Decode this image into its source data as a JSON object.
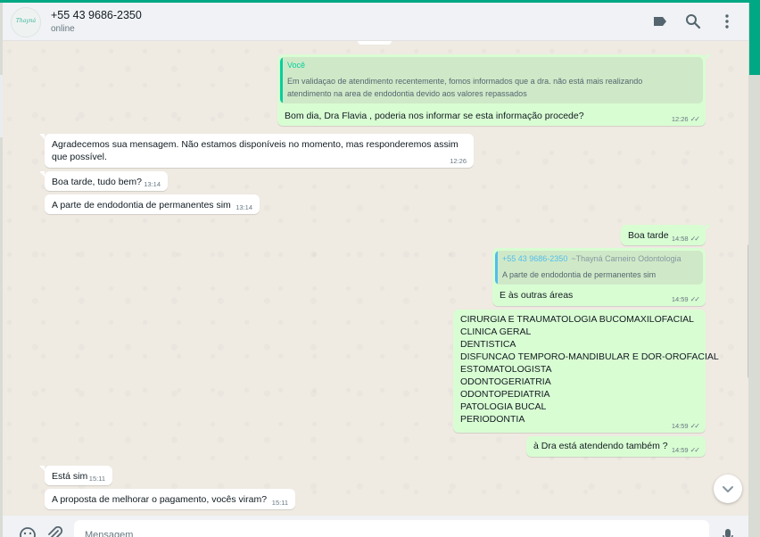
{
  "header": {
    "avatar_text": "Thayná",
    "contact_name": "+55 43 9686-2350",
    "status": "online",
    "icons": [
      "label-icon",
      "search-icon",
      "menu-icon"
    ]
  },
  "messages": [
    {
      "dir": "out",
      "quote": {
        "author": "Você",
        "sub": "",
        "text": "Em validaçao de atendimento recentemente, fomos informados que a dra. não está mais realizando\natendimento na area de endodontia devido aos valores repassados"
      },
      "text": "Bom dia, Dra Flavia , poderia nos informar se esta informação procede?",
      "time": "12:26",
      "ticks": "✓✓"
    },
    {
      "dir": "in",
      "text": "Agradecemos sua mensagem. Não estamos disponíveis no momento, mas responderemos assim\nque possível.",
      "time": "12:26"
    },
    {
      "dir": "in",
      "text": "Boa tarde, tudo bem?",
      "time": "13:14"
    },
    {
      "dir": "in",
      "text": "A parte de endodontia de permanentes sim",
      "time": "13:14"
    },
    {
      "dir": "out",
      "text": "Boa tarde",
      "time": "14:58",
      "ticks": "✓✓"
    },
    {
      "dir": "out",
      "quote": {
        "author": "+55 43 9686-2350",
        "sub": "~Thayná Carneiro Odontologia",
        "text": "A parte de endodontia de permanentes sim"
      },
      "text": "E às outras áreas",
      "time": "14:59",
      "ticks": "✓✓"
    },
    {
      "dir": "out",
      "text": "CIRURGIA E TRAUMATOLOGIA BUCOMAXILOFACIAL\nCLINICA GERAL\nDENTISTICA\nDISFUNCAO TEMPORO-MANDIBULAR E DOR-OROFACIAL\nESTOMATOLOGISTA\nODONTOGERIATRIA\nODONTOPEDIATRIA\nPATOLOGIA BUCAL\nPERIODONTIA",
      "time": "14:59",
      "ticks": "✓✓"
    },
    {
      "dir": "out",
      "text": "à Dra está atendendo também ?",
      "time": "14:59",
      "ticks": "✓✓"
    },
    {
      "dir": "in",
      "text": "Está sim",
      "time": "15:11"
    },
    {
      "dir": "in",
      "text": "A proposta de melhorar o pagamento, vocês viram?",
      "time": "15:11"
    }
  ],
  "footer": {
    "placeholder": "Mensagem",
    "icons": [
      "emoji-icon",
      "attach-icon",
      "mic-icon"
    ]
  },
  "colors": {
    "accent": "#00a884",
    "outgoing_bubble": "#d9fdd3",
    "incoming_bubble": "#ffffff",
    "chat_background": "#efeae2",
    "quote_self": "#06cf9c",
    "quote_other": "#53bdeb"
  }
}
